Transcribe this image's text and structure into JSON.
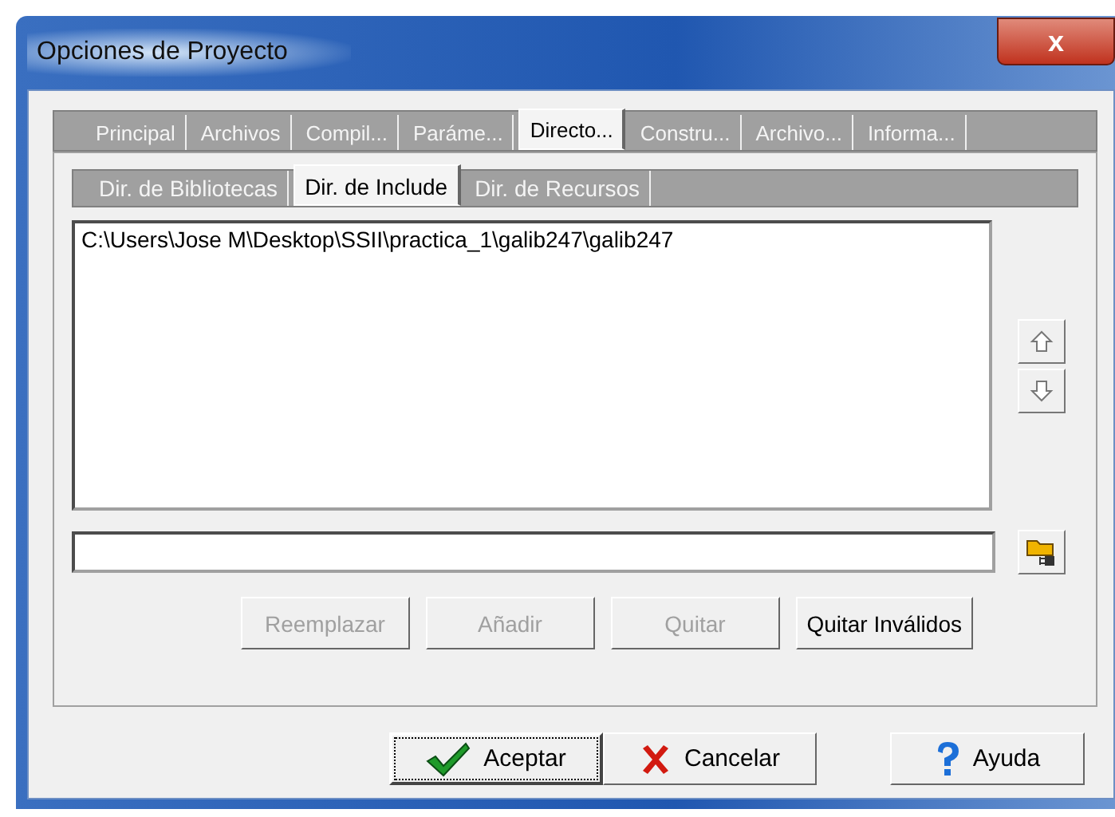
{
  "window": {
    "title": "Opciones de Proyecto",
    "close": "x"
  },
  "tabs": [
    {
      "label": "Principal",
      "selected": false
    },
    {
      "label": "Archivos",
      "selected": false
    },
    {
      "label": "Compil...",
      "selected": false
    },
    {
      "label": "Paráme...",
      "selected": false
    },
    {
      "label": "Directo...",
      "selected": true
    },
    {
      "label": "Constru...",
      "selected": false
    },
    {
      "label": "Archivo...",
      "selected": false
    },
    {
      "label": "Informa...",
      "selected": false
    }
  ],
  "subtabs": [
    {
      "label": "Dir. de Bibliotecas",
      "selected": false
    },
    {
      "label": "Dir. de Include",
      "selected": true
    },
    {
      "label": "Dir. de Recursos",
      "selected": false
    }
  ],
  "directories": [
    "C:\\Users\\Jose M\\Desktop\\SSII\\practica_1\\galib247\\galib247"
  ],
  "actions": [
    {
      "label": "Reemplazar",
      "disabled": true
    },
    {
      "label": "Añadir",
      "disabled": true
    },
    {
      "label": "Quitar",
      "disabled": true
    },
    {
      "label": "Quitar Inválidos",
      "disabled": false
    }
  ],
  "buttons": [
    {
      "kind": "ok",
      "label": "Aceptar"
    },
    {
      "kind": "cancel",
      "label": "Cancelar"
    },
    {
      "kind": "help",
      "label": "Ayuda"
    }
  ]
}
